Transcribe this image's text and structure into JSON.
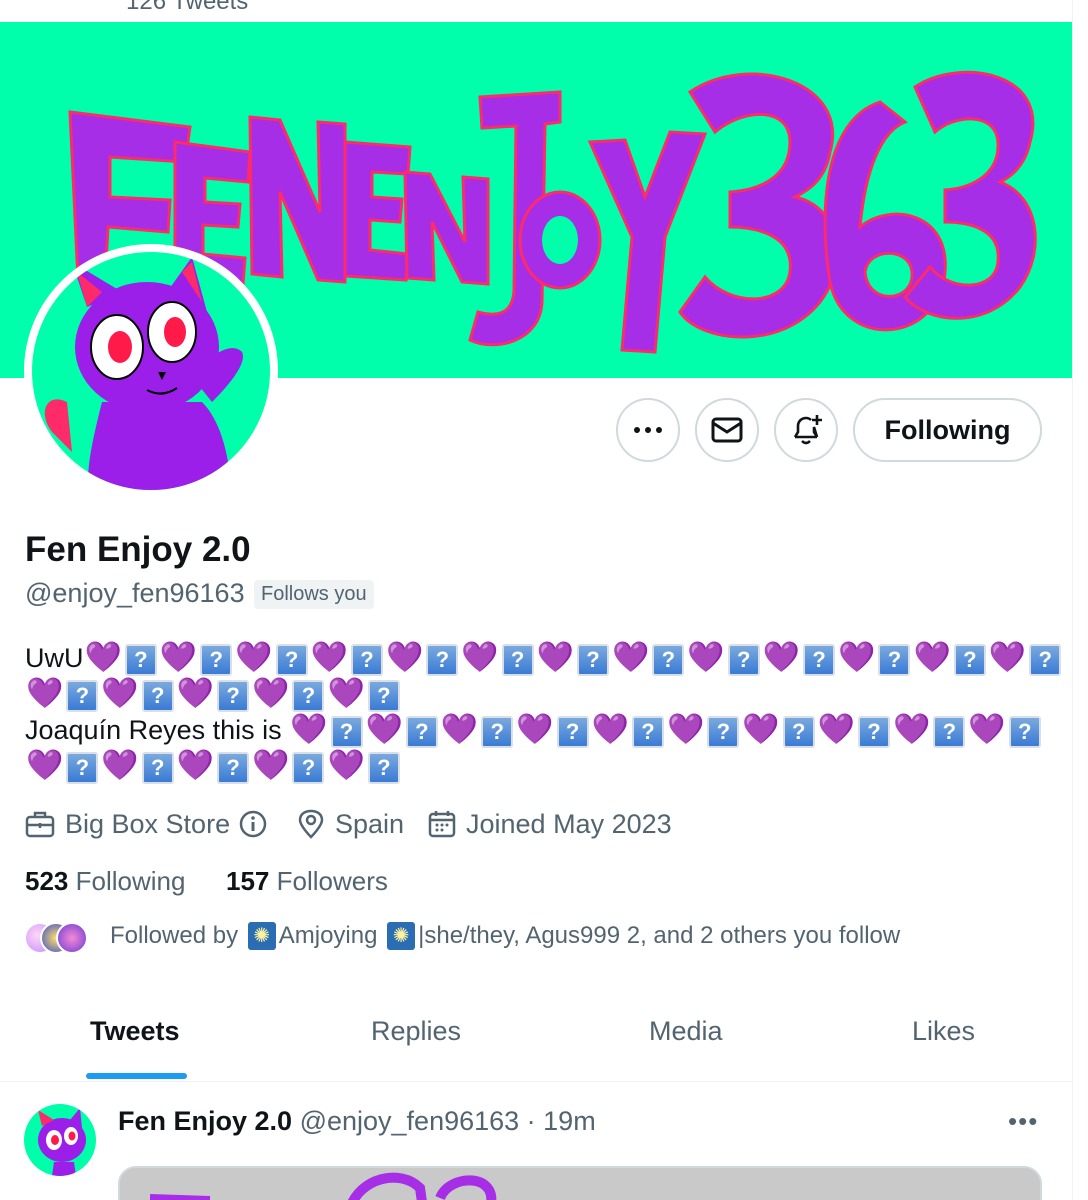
{
  "header": {
    "tweet_count": "126 Tweets"
  },
  "banner": {
    "text": "FENENJOY363",
    "bg_color": "#00ffaa",
    "text_color": "#a52ee6"
  },
  "actions": {
    "more_icon": "more-horizontal-icon",
    "message_icon": "envelope-icon",
    "notify_icon": "bell-plus-icon",
    "following_label": "Following"
  },
  "profile": {
    "name": "Fen Enjoy 2.0",
    "handle": "@enjoy_fen96163",
    "follows_you": "Follows you",
    "bio_line1_prefix": "UwU",
    "bio_line3_prefix": "Joaquín Reyes this is",
    "qbox_glyph": "?",
    "heart_glyph": "💜"
  },
  "meta": {
    "category": "Big Box Store",
    "location": "Spain",
    "joined": "Joined May 2023"
  },
  "stats": {
    "following_count": "523",
    "following_label": "Following",
    "followers_count": "157",
    "followers_label": "Followers"
  },
  "followed_by": {
    "prefix": "Followed by",
    "name1": "Amjoying",
    "name2": "|she/they, Agus999 2, and 2 others you follow"
  },
  "tabs": [
    {
      "label": "Tweets"
    },
    {
      "label": "Replies"
    },
    {
      "label": "Media"
    },
    {
      "label": "Likes"
    }
  ],
  "tweet": {
    "name": "Fen Enjoy 2.0",
    "meta": "@enjoy_fen96163 · 19m",
    "more": "•••"
  }
}
